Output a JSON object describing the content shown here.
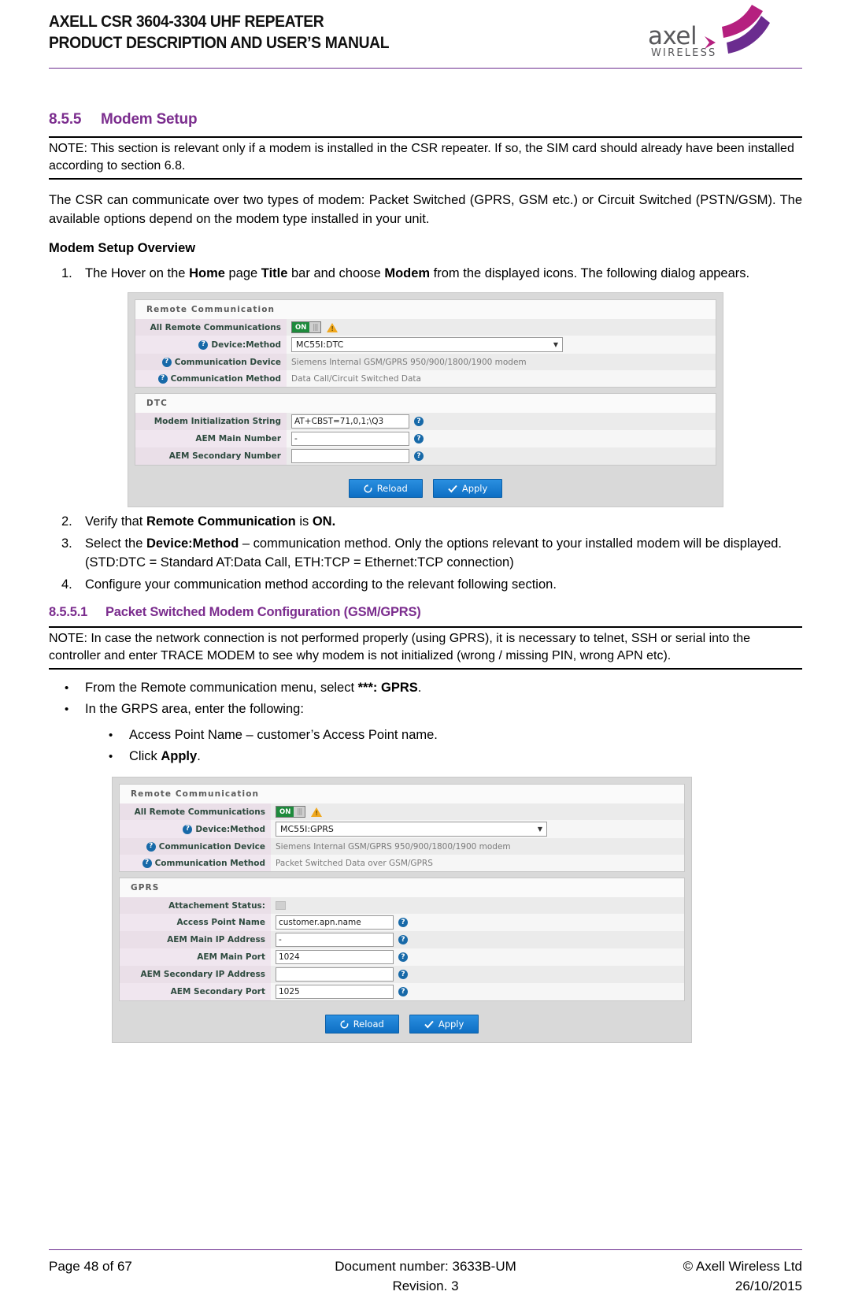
{
  "header": {
    "title_line1": "AXELL CSR 3604-3304 UHF REPEATER",
    "title_line2": "PRODUCT DESCRIPTION AND USER’S MANUAL",
    "logo_wordmark": "axel",
    "logo_sub": "WIRELESS",
    "accent_color": "#6b2c8f"
  },
  "section": {
    "number": "8.5.5",
    "title": "Modem Setup",
    "note": "NOTE: This section is relevant only if a modem is installed in the CSR repeater. If so, the SIM card should already have been installed according to section 6.8.",
    "paragraph_a": "The CSR can communicate over two types of modem: Packet Switched (GPRS, GSM etc.)",
    "paragraph_b": "or Circuit Switched (PSTN/GSM). The available options depend on the modem type installed",
    "paragraph_c": "in your unit.",
    "overview_heading": "Modem Setup Overview"
  },
  "steps": {
    "s1_num": "1.",
    "s1_a": "The Hover on the ",
    "s1_home": "Home",
    "s1_b": " page ",
    "s1_title": "Title",
    "s1_c": " bar and choose ",
    "s1_modem": "Modem",
    "s1_d": " from the displayed icons. The following dialog appears.",
    "s2_num": "2.",
    "s2_a": "Verify that ",
    "s2_rc": "Remote Communication",
    "s2_b": " is ",
    "s2_on": "ON.",
    "s3_num": "3.",
    "s3_a": "Select the ",
    "s3_dm": "Device:Method",
    "s3_b": " – communication method. Only the options relevant to your installed modem will be displayed. (STD:DTC = Standard AT:Data Call, ETH:TCP = Ethernet:TCP connection)",
    "s4_num": "4.",
    "s4_a": "Configure your communication method according to the relevant following section."
  },
  "subsection": {
    "number": "8.5.5.1",
    "title": "Packet Switched Modem Configuration (GSM/GPRS)",
    "note": "NOTE: In case the network connection is not performed properly (using GPRS), it is necessary to telnet, SSH or serial into the controller and enter TRACE MODEM to see why modem is not initialized (wrong / missing PIN, wrong APN etc).",
    "b1_a": "From the Remote communication menu, select ",
    "b1_b": "***: GPRS",
    "b1_c": ".",
    "b2": "In the GRPS area, enter the following:",
    "b3": "Access Point Name – customer’s Access Point name.",
    "b4_a": "Click ",
    "b4_b": "Apply",
    "b4_c": "."
  },
  "ui_dtc": {
    "card1_title": "Remote Communication",
    "rows": [
      {
        "label": "All Remote Communications",
        "help": false,
        "type": "toggle",
        "toggle_text": "ON"
      },
      {
        "label": "Device:Method",
        "help": true,
        "type": "select",
        "value": "MC55I:DTC"
      },
      {
        "label": "Communication Device",
        "help": true,
        "type": "text",
        "value": "Siemens Internal GSM/GPRS 950/900/1800/1900 modem"
      },
      {
        "label": "Communication Method",
        "help": true,
        "type": "text",
        "value": "Data Call/Circuit Switched Data"
      }
    ],
    "card2_title": "DTC",
    "rows2": [
      {
        "label": "Modem Initialization String",
        "type": "input",
        "value": "AT+CBST=71,0,1;\\Q3",
        "help": true
      },
      {
        "label": "AEM Main Number",
        "type": "input",
        "value": "-",
        "help": true
      },
      {
        "label": "AEM Secondary Number",
        "type": "input",
        "value": "",
        "help": true
      }
    ],
    "reload_label": "Reload",
    "apply_label": "Apply"
  },
  "ui_gprs": {
    "card1_title": "Remote Communication",
    "rows": [
      {
        "label": "All Remote Communications",
        "help": false,
        "type": "toggle",
        "toggle_text": "ON"
      },
      {
        "label": "Device:Method",
        "help": true,
        "type": "select",
        "value": "MC55I:GPRS"
      },
      {
        "label": "Communication Device",
        "help": true,
        "type": "text",
        "value": "Siemens Internal GSM/GPRS 950/900/1800/1900 modem"
      },
      {
        "label": "Communication Method",
        "help": true,
        "type": "text",
        "value": "Packet Switched Data over GSM/GPRS"
      }
    ],
    "card2_title": "GPRS",
    "rows2": [
      {
        "label": "Attachement Status:",
        "type": "status",
        "value": "",
        "help": false
      },
      {
        "label": "Access Point Name",
        "type": "input",
        "value": "customer.apn.name",
        "help": true
      },
      {
        "label": "AEM Main IP Address",
        "type": "input",
        "value": "-",
        "help": true
      },
      {
        "label": "AEM Main Port",
        "type": "input",
        "value": "1024",
        "help": true
      },
      {
        "label": "AEM Secondary IP Address",
        "type": "input",
        "value": "",
        "help": true
      },
      {
        "label": "AEM Secondary Port",
        "type": "input",
        "value": "1025",
        "help": true
      }
    ],
    "reload_label": "Reload",
    "apply_label": "Apply"
  },
  "footer": {
    "page": "Page 48 of 67",
    "doc_number": "Document number: 3633B-UM",
    "revision": "Revision. 3",
    "copyright": "© Axell Wireless Ltd",
    "date": "26/10/2015"
  }
}
